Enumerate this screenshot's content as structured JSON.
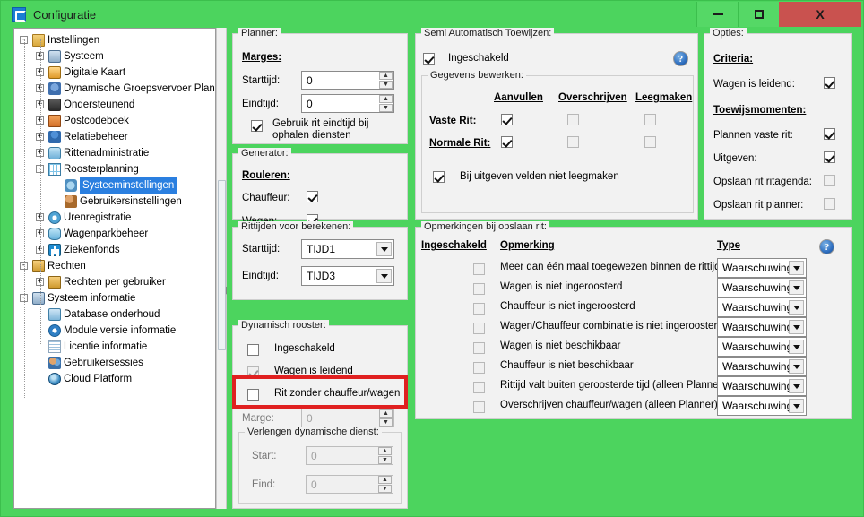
{
  "window": {
    "title": "Configuratie",
    "app_icon": "app-icon",
    "minimize_label": "minimize",
    "maximize_label": "maximize",
    "close_label": "X",
    "titlebar_color": "#4cd45e",
    "close_color": "#c9524f"
  },
  "tree": {
    "nodes": [
      {
        "label": "Instellingen",
        "depth": 0,
        "expander": "-",
        "icon": "folder-icon",
        "selected": false
      },
      {
        "label": "Systeem",
        "depth": 1,
        "expander": "+",
        "icon": "monitor-icon",
        "selected": false
      },
      {
        "label": "Digitale Kaart",
        "depth": 1,
        "expander": "+",
        "icon": "map-icon",
        "selected": false
      },
      {
        "label": "Dynamische Groepsvervoer Planning",
        "depth": 1,
        "expander": "+",
        "icon": "people-icon",
        "selected": false
      },
      {
        "label": "Ondersteunend",
        "depth": 1,
        "expander": "+",
        "icon": "support-icon",
        "selected": false
      },
      {
        "label": "Postcodeboek",
        "depth": 1,
        "expander": "+",
        "icon": "book-icon",
        "selected": false
      },
      {
        "label": "Relatiebeheer",
        "depth": 1,
        "expander": "+",
        "icon": "person-icon",
        "selected": false
      },
      {
        "label": "Rittenadministratie",
        "depth": 1,
        "expander": "+",
        "icon": "bus-icon",
        "selected": false
      },
      {
        "label": "Roosterplanning",
        "depth": 1,
        "expander": "-",
        "icon": "grid-icon",
        "selected": false
      },
      {
        "label": "Systeeminstellingen",
        "depth": 2,
        "expander": "",
        "icon": "gear-icon",
        "selected": true
      },
      {
        "label": "Gebruikersinstellingen",
        "depth": 2,
        "expander": "",
        "icon": "user-gear-icon",
        "selected": false
      },
      {
        "label": "Urenregistratie",
        "depth": 1,
        "expander": "+",
        "icon": "clock-icon",
        "selected": false
      },
      {
        "label": "Wagenparkbeheer",
        "depth": 1,
        "expander": "+",
        "icon": "car-icon",
        "selected": false
      },
      {
        "label": "Ziekenfonds",
        "depth": 1,
        "expander": "+",
        "icon": "health-icon",
        "selected": false
      },
      {
        "label": "Rechten",
        "depth": 0,
        "expander": "-",
        "icon": "lock-icon",
        "selected": false
      },
      {
        "label": "Rechten per gebruiker",
        "depth": 1,
        "expander": "+",
        "icon": "lock-icon",
        "selected": false
      },
      {
        "label": "Systeem informatie",
        "depth": 0,
        "expander": "-",
        "icon": "monitor-icon",
        "selected": false
      },
      {
        "label": "Database onderhoud",
        "depth": 1,
        "expander": "",
        "icon": "database-icon",
        "selected": false
      },
      {
        "label": "Module versie informatie",
        "depth": 1,
        "expander": "",
        "icon": "info-icon",
        "selected": false
      },
      {
        "label": "Licentie informatie",
        "depth": 1,
        "expander": "",
        "icon": "document-icon",
        "selected": false
      },
      {
        "label": "Gebruikersessies",
        "depth": 1,
        "expander": "",
        "icon": "users-icon",
        "selected": false
      },
      {
        "label": "Cloud Platform",
        "depth": 1,
        "expander": "",
        "icon": "globe-icon",
        "selected": false
      }
    ]
  },
  "planner": {
    "caption": "Planner:",
    "marges_heading": "Marges:",
    "starttijd_label": "Starttijd:",
    "starttijd_value": "0",
    "eindtijd_label": "Eindtijd:",
    "eindtijd_value": "0",
    "gebruik_rit_label": "Gebruik rit eindtijd bij ophalen diensten",
    "gebruik_rit_checked": true
  },
  "generator": {
    "caption": "Generator:",
    "rouleren_heading": "Rouleren:",
    "chauffeur_label": "Chauffeur:",
    "chauffeur_checked": true,
    "wagen_label": "Wagen:",
    "wagen_checked": true
  },
  "rittijden": {
    "caption": "Rittijden voor berekenen:",
    "starttijd_label": "Starttijd:",
    "starttijd_value": "TIJD1",
    "eindtijd_label": "Eindtijd:",
    "eindtijd_value": "TIJD3"
  },
  "dynamisch": {
    "caption": "Dynamisch rooster:",
    "ingeschakeld_label": "Ingeschakeld",
    "ingeschakeld_checked": false,
    "wagen_leidend_label": "Wagen is leidend",
    "wagen_leidend_checked": true,
    "rit_zonder_label": "Rit zonder chauffeur/wagen",
    "rit_zonder_checked": false,
    "marge_label": "Marge:",
    "marge_value": "0",
    "verlengen_caption": "Verlengen dynamische dienst:",
    "start_label": "Start:",
    "start_value": "0",
    "eind_label": "Eind:",
    "eind_value": "0"
  },
  "semi_auto": {
    "caption": "Semi Automatisch Toewijzen:",
    "ingeschakeld_label": "Ingeschakeld",
    "ingeschakeld_checked": true,
    "help_icon": "?",
    "gegevens_caption": "Gegevens bewerken:",
    "columns": [
      "Aanvullen",
      "Overschrijven",
      "Leegmaken"
    ],
    "rows": [
      {
        "label": "Vaste Rit:",
        "aanvullen": true,
        "overschrijven": false,
        "leegmaken": false
      },
      {
        "label": "Normale Rit:",
        "aanvullen": true,
        "overschrijven": false,
        "leegmaken": false
      }
    ],
    "bij_uitgeven_label": "Bij uitgeven velden niet leegmaken",
    "bij_uitgeven_checked": true
  },
  "opties": {
    "caption": "Opties:",
    "criteria_heading": "Criteria:",
    "wagen_leidend_label": "Wagen is leidend:",
    "wagen_leidend_checked": true,
    "toewijs_heading": "Toewijsmomenten:",
    "items": [
      {
        "label": "Plannen vaste rit:",
        "checked": true,
        "disabled": false
      },
      {
        "label": "Uitgeven:",
        "checked": true,
        "disabled": false
      },
      {
        "label": "Opslaan rit ritagenda:",
        "checked": false,
        "disabled": true
      },
      {
        "label": "Opslaan rit planner:",
        "checked": false,
        "disabled": true
      }
    ]
  },
  "opmerkingen": {
    "caption": "Opmerkingen bij opslaan rit:",
    "columns": [
      "Ingeschakeld",
      "Opmerking",
      "Type"
    ],
    "help_icon": "?",
    "rows": [
      {
        "checked": false,
        "text": "Meer dan één maal toegewezen binnen de rittijd",
        "type": "Waarschuwing"
      },
      {
        "checked": false,
        "text": "Wagen is niet ingeroosterd",
        "type": "Waarschuwing"
      },
      {
        "checked": false,
        "text": "Chauffeur is niet ingeroosterd",
        "type": "Waarschuwing"
      },
      {
        "checked": false,
        "text": "Wagen/Chauffeur combinatie is niet ingeroosterd",
        "type": "Waarschuwing"
      },
      {
        "checked": false,
        "text": "Wagen is niet beschikbaar",
        "type": "Waarschuwing"
      },
      {
        "checked": false,
        "text": "Chauffeur is niet beschikbaar",
        "type": "Waarschuwing"
      },
      {
        "checked": false,
        "text": "Rittijd valt buiten geroosterde tijd (alleen Planner)",
        "type": "Waarschuwing"
      },
      {
        "checked": false,
        "text": "Overschrijven chauffeur/wagen (alleen Planner)",
        "type": "Waarschuwing"
      }
    ]
  },
  "annotation": {
    "highlight_color": "#e02020",
    "highlight_target": "Rit zonder chauffeur/wagen"
  }
}
